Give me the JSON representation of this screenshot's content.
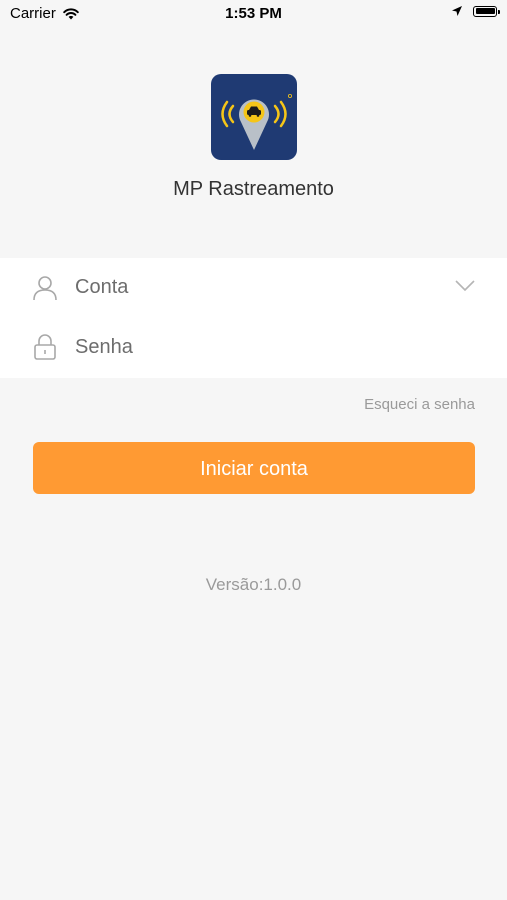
{
  "status_bar": {
    "carrier": "Carrier",
    "time": "1:53 PM",
    "icons": [
      "wifi-icon",
      "location-arrow-icon",
      "battery-icon"
    ]
  },
  "app": {
    "name": "MP Rastreamento",
    "logo_icon": "car-location-pin-icon",
    "colors": {
      "logo_background": "#1f3a73",
      "logo_accent": "#f5c518",
      "primary_button": "#ff9a33"
    }
  },
  "login_form": {
    "account_placeholder": "Conta",
    "account_icon": "user-icon",
    "dropdown_icon": "chevron-down-icon",
    "password_placeholder": "Senha",
    "password_icon": "lock-icon",
    "forgot_password_label": "Esqueci a senha",
    "submit_label": "Iniciar conta"
  },
  "footer": {
    "version_text": "Versão:1.0.0"
  }
}
